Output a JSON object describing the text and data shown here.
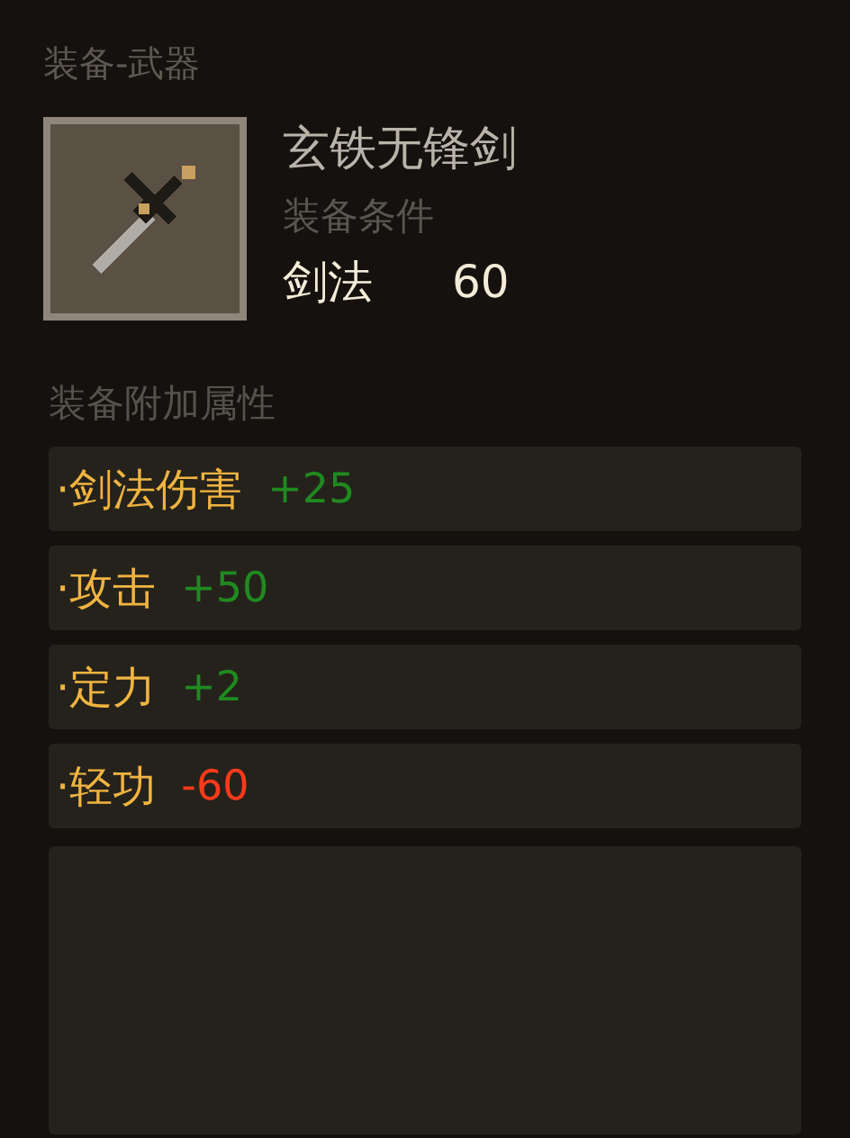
{
  "category": "装备-武器",
  "item": {
    "name": "玄铁无锋剑",
    "requirement_label": "装备条件",
    "requirement": {
      "skill": "剑法",
      "value": "60"
    }
  },
  "bonus_header": "装备附加属性",
  "bonuses": [
    {
      "label": "·剑法伤害",
      "value": "+25",
      "kind": "bonus"
    },
    {
      "label": "·攻击",
      "value": "+50",
      "kind": "bonus"
    },
    {
      "label": "·定力",
      "value": "+2",
      "kind": "bonus"
    },
    {
      "label": "·轻功",
      "value": "-60",
      "kind": "penalty"
    }
  ]
}
